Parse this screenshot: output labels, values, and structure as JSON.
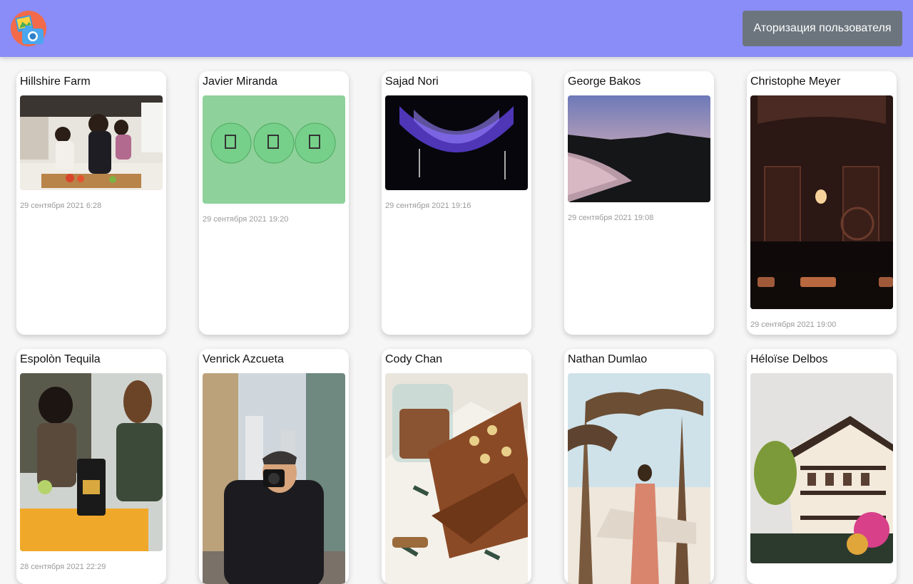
{
  "header": {
    "logo_icon": "photo-camera-app-logo",
    "auth_button_label": "Аторизация пользователя",
    "background_color": "#8a8cf8",
    "button_color": "#6c757d"
  },
  "cards": [
    {
      "author": "Hillshire Farm",
      "date": "29 сентября 2021 6:28"
    },
    {
      "author": "Javier Miranda",
      "date": "29 сентября 2021 19:20"
    },
    {
      "author": "Sajad Nori",
      "date": "29 сентября 2021 19:16"
    },
    {
      "author": "George Bakos",
      "date": "29 сентября 2021 19:08"
    },
    {
      "author": "Christophe Meyer",
      "date": "29 сентября 2021 19:00"
    },
    {
      "author": "Espolòn Tequila",
      "date": "28 сентября 2021 22:29"
    },
    {
      "author": "Venrick Azcueta",
      "date": ""
    },
    {
      "author": "Cody Chan",
      "date": ""
    },
    {
      "author": "Nathan Dumlao",
      "date": ""
    },
    {
      "author": "Héloïse Delbos",
      "date": ""
    }
  ]
}
